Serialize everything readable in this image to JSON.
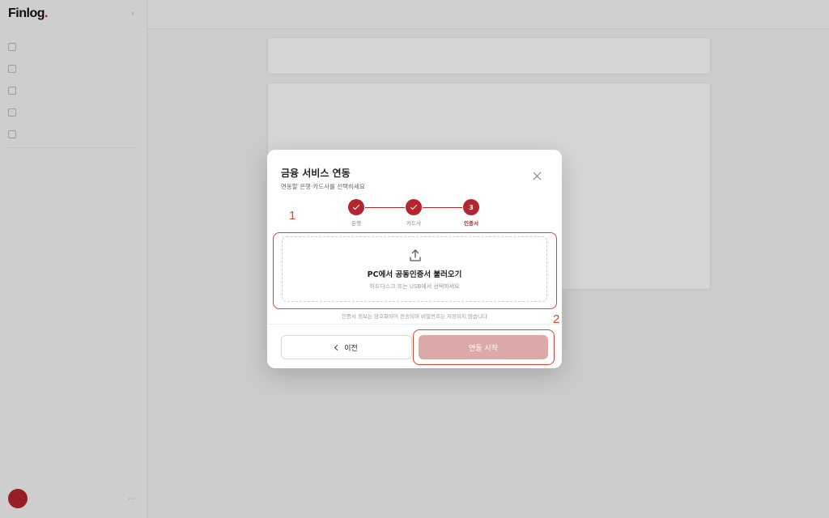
{
  "colors": {
    "accent": "#b3262d",
    "start_button_disabled": "#dca9a9",
    "annotation": "#d9442a"
  },
  "background": {
    "logo": "Finlog",
    "logo_dot": "."
  },
  "modal": {
    "title": "금융 서비스 연동",
    "subtitle": "연동할 은행·카드사를 선택하세요",
    "close_icon": "close-icon",
    "steps": [
      {
        "label": "은행",
        "state": "done",
        "icon": "check-icon"
      },
      {
        "label": "카드사",
        "state": "done",
        "icon": "check-icon"
      },
      {
        "label": "인증서",
        "state": "active",
        "number": "3"
      }
    ],
    "upload": {
      "icon": "upload-icon",
      "title": "PC에서 공동인증서 불러오기",
      "subtitle": "하드디스크 또는 USB에서 선택하세요"
    },
    "security_note": "인증서 정보는 암호화되어 전송되며 비밀번호는 저장되지 않습니다",
    "prev_button": "이전",
    "start_button": "연동 시작"
  },
  "annotations": [
    "1",
    "2"
  ]
}
